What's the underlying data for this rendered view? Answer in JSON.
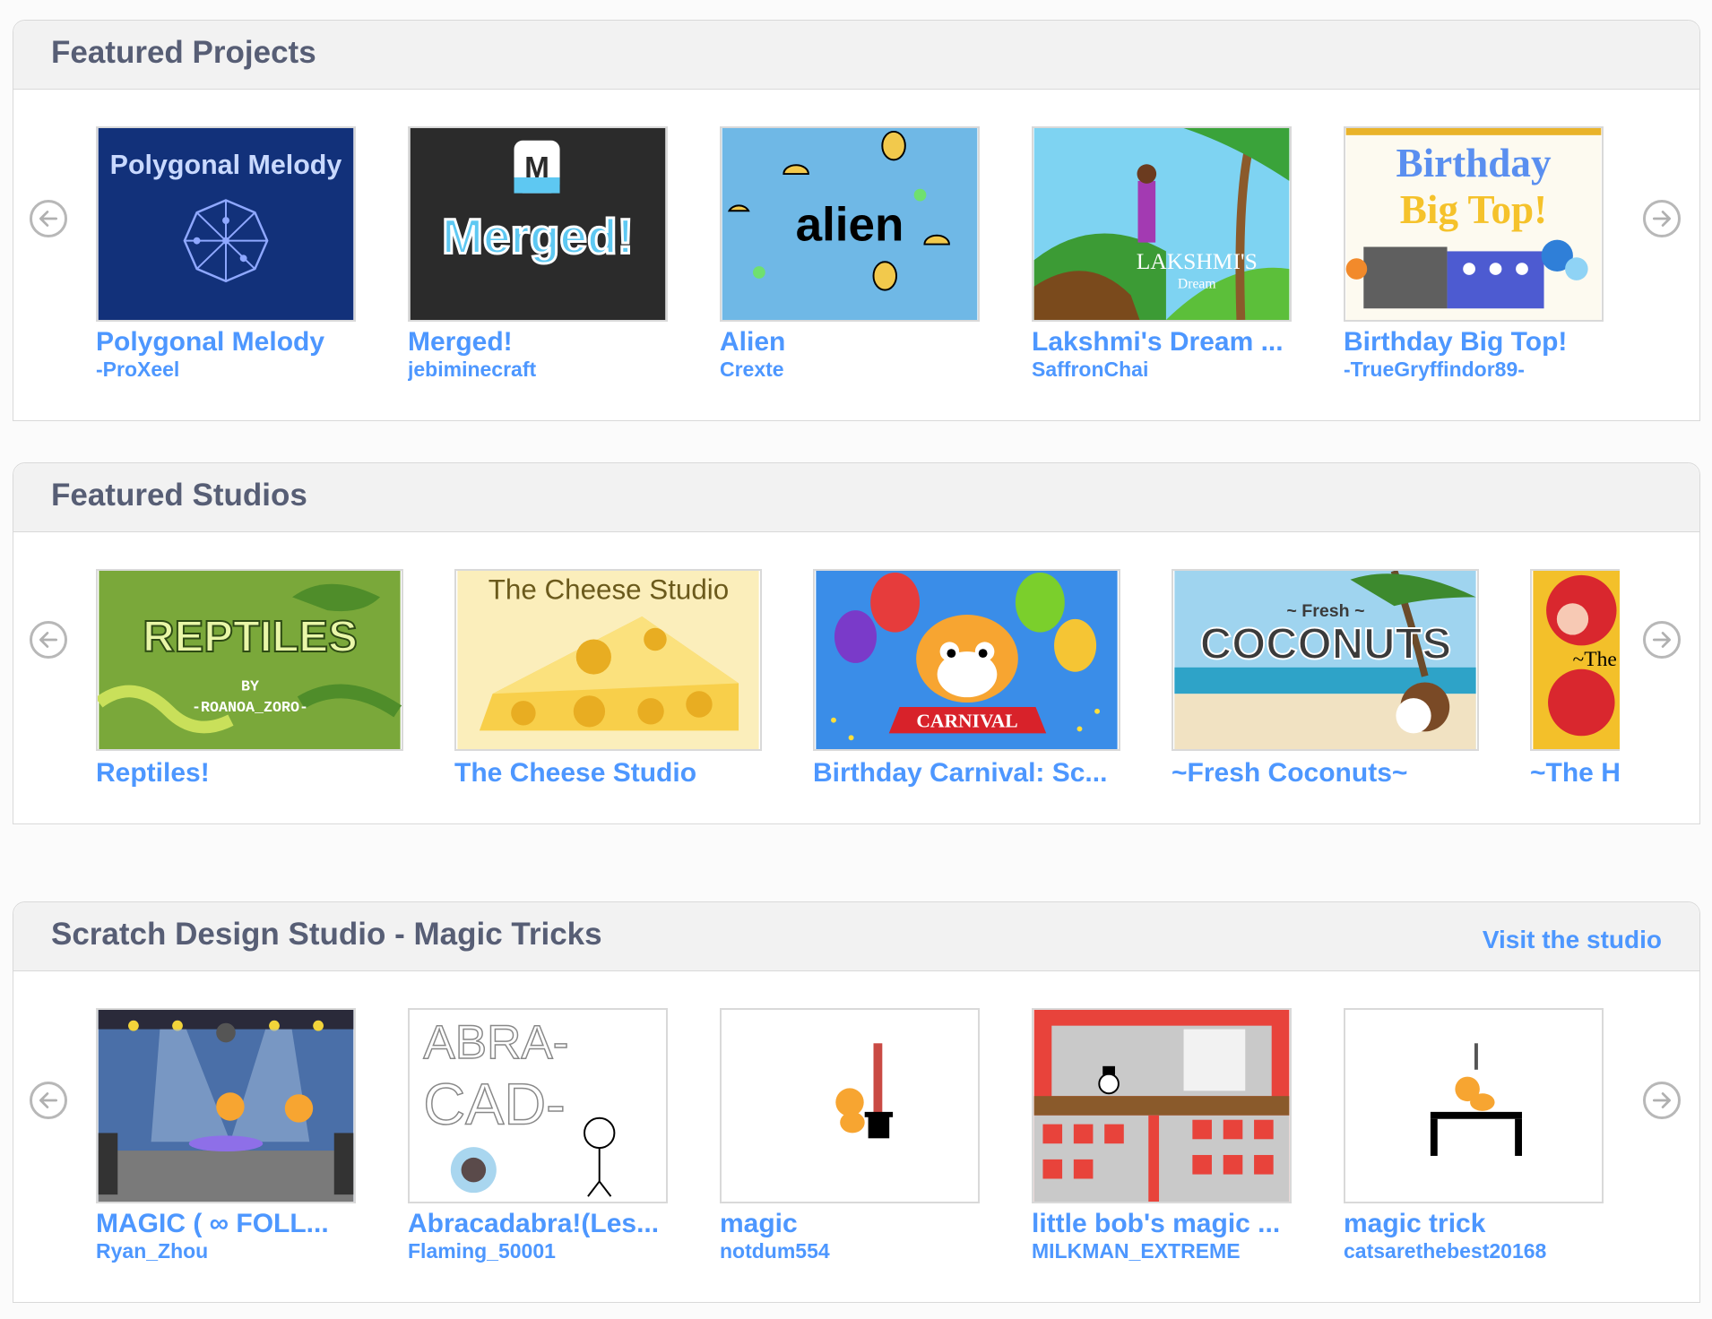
{
  "featured_projects": {
    "title": "Featured Projects",
    "items": [
      {
        "title": "Polygonal Melody",
        "author": "-ProXeel",
        "thumb_text": "Polygonal Melody"
      },
      {
        "title": "Merged!",
        "author": "jebiminecraft",
        "thumb_text": "Merged!",
        "thumb_logo": "M"
      },
      {
        "title": "Alien",
        "author": "Crexte",
        "thumb_text": "alien"
      },
      {
        "title": "Lakshmi's Dream ...",
        "author": "SaffronChai",
        "thumb_text": "LAKSHMI'S",
        "thumb_sub": "Dream"
      },
      {
        "title": "Birthday Big Top!",
        "author": "-TrueGryffindor89-",
        "thumb_text": "Birthday",
        "thumb_sub": "Big Top!"
      }
    ]
  },
  "featured_studios": {
    "title": "Featured Studios",
    "items": [
      {
        "title": "Reptiles!",
        "thumb_text": "REPTILES",
        "thumb_sub": "BY",
        "thumb_sub2": "-ROANOA_ZORO-"
      },
      {
        "title": "The Cheese Studio",
        "thumb_text": "The Cheese Studio"
      },
      {
        "title": "Birthday Carnival: Sc...",
        "thumb_text": "CARNIVAL"
      },
      {
        "title": "~Fresh Coconuts~",
        "thumb_text": "COCONUTS",
        "thumb_sub": "~ Fresh ~"
      },
      {
        "title": "~The H",
        "thumb_text": "~The"
      }
    ]
  },
  "magic_studio": {
    "title": "Scratch Design Studio - Magic Tricks",
    "visit_label": "Visit the studio",
    "items": [
      {
        "title": "MAGIC ( ∞ FOLL...",
        "author": "Ryan_Zhou"
      },
      {
        "title": "Abracadabra!(Les...",
        "author": "Flaming_50001",
        "thumb_text": "ABRA-",
        "thumb_sub": "CAD-"
      },
      {
        "title": "magic",
        "author": "notdum554"
      },
      {
        "title": "little bob's magic ...",
        "author": "MILKMAN_EXTREME"
      },
      {
        "title": "magic trick",
        "author": "catsarethebest20168"
      }
    ]
  },
  "colors": {
    "link": "#4d97ff",
    "header_text": "#575e75",
    "header_bg": "#f2f2f2",
    "border": "#d9d9d9"
  },
  "icons": {
    "prev": "arrow-left-circle-icon",
    "next": "arrow-right-circle-icon"
  }
}
